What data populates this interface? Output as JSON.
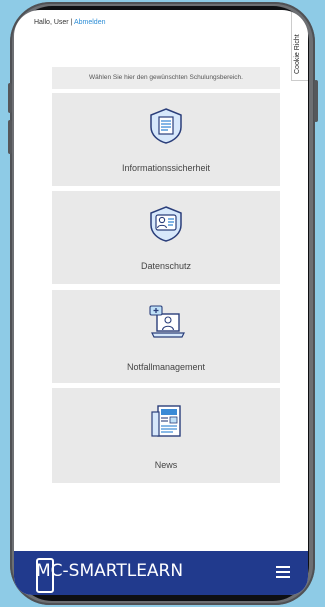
{
  "header": {
    "greeting": "Hallo, User |",
    "logout_link": "Abmelden"
  },
  "cookie_tab": {
    "label": "Cookie Richt"
  },
  "intro_text": "Wählen Sie hier den gewünschten Schulungsbereich.",
  "cards": [
    {
      "label": "Informationssicherheit",
      "icon": "shield-document-icon"
    },
    {
      "label": "Datenschutz",
      "icon": "shield-person-icon"
    },
    {
      "label": "Notfallmanagement",
      "icon": "laptop-support-icon"
    },
    {
      "label": "News",
      "icon": "newspaper-icon"
    }
  ],
  "brand": {
    "logo_text": "MC-SMARTLEARN"
  },
  "colors": {
    "accent": "#2c8dd6",
    "navbar": "#213a8d",
    "card_bg": "#e9e9e9",
    "background": "#8ecbe6"
  }
}
